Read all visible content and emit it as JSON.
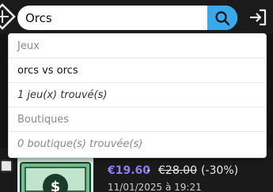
{
  "search": {
    "value": "Orcs",
    "placeholder": ""
  },
  "dropdown": {
    "games_header": "Jeux",
    "game_result": "orcs vs orcs",
    "games_count": "1 jeu(x) trouvé(s)",
    "shops_header": "Boutiques",
    "shops_count": "0 boutique(s) trouvée(s)"
  },
  "deal": {
    "price_current": "€19.60",
    "separator": "-",
    "price_old": "€28.00",
    "discount": "(-30%)",
    "date": "11/01/2025 à 19:21"
  },
  "icons": {
    "logo": "diamond-logo-icon",
    "search": "search-icon",
    "login": "login-arrow-icon",
    "dollar": "dollar-icon"
  },
  "colors": {
    "accent": "#39a9ec",
    "price": "#8e7cf3",
    "background": "#141414"
  }
}
